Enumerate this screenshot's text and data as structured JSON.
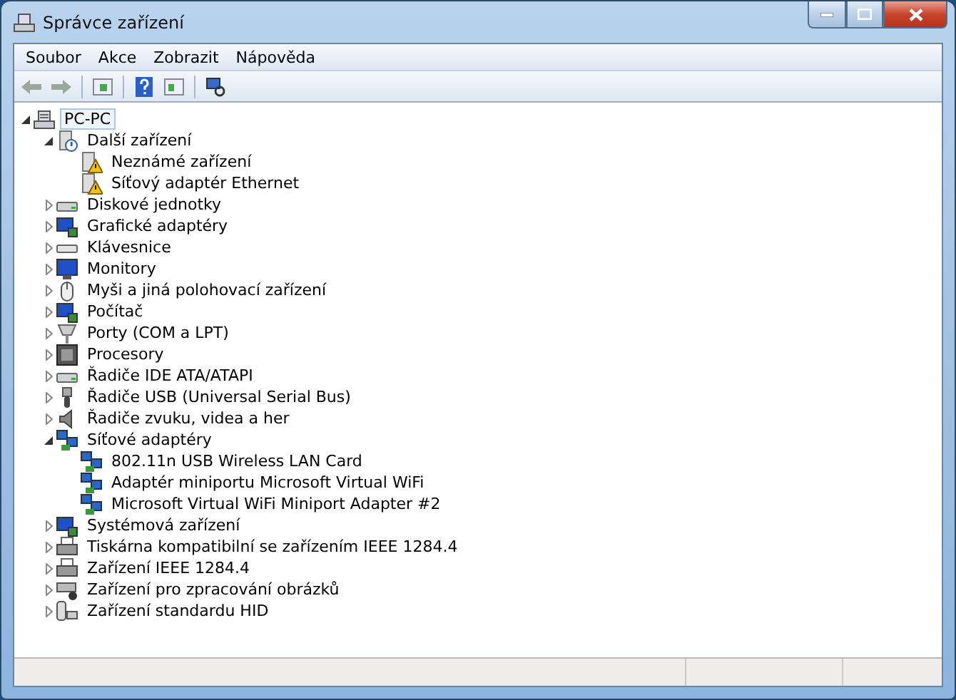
{
  "window": {
    "title": "Správce zařízení"
  },
  "menu": [
    "Soubor",
    "Akce",
    "Zobrazit",
    "Nápověda"
  ],
  "tree": [
    {
      "label": "PC-PC",
      "kind": "computer",
      "selected": true,
      "expanded": true,
      "children": [
        {
          "label": "Další zařízení",
          "kind": "unknown",
          "selected": false,
          "expanded": true,
          "children": [
            {
              "label": "Neznámé zařízení",
              "kind": "warning",
              "selected": false
            },
            {
              "label": "Síťový adaptér Ethernet",
              "kind": "warning",
              "selected": false
            }
          ]
        },
        {
          "label": "Diskové jednotky",
          "kind": "disk",
          "selected": false,
          "expanded": false
        },
        {
          "label": "Grafické adaptéry",
          "kind": "display",
          "selected": false,
          "expanded": false
        },
        {
          "label": "Klávesnice",
          "kind": "keyboard",
          "selected": false,
          "expanded": false
        },
        {
          "label": "Monitory",
          "kind": "monitor",
          "selected": false,
          "expanded": false
        },
        {
          "label": "Myši a jiná polohovací zařízení",
          "kind": "mouse",
          "selected": false,
          "expanded": false
        },
        {
          "label": "Počítač",
          "kind": "display",
          "selected": false,
          "expanded": false
        },
        {
          "label": "Porty (COM a LPT)",
          "kind": "port",
          "selected": false,
          "expanded": false
        },
        {
          "label": "Procesory",
          "kind": "cpu",
          "selected": false,
          "expanded": false
        },
        {
          "label": "Řadiče IDE ATA/ATAPI",
          "kind": "disk",
          "selected": false,
          "expanded": false
        },
        {
          "label": "Řadiče USB (Universal Serial Bus)",
          "kind": "usb",
          "selected": false,
          "expanded": false
        },
        {
          "label": "Řadiče zvuku, videa a her",
          "kind": "sound",
          "selected": false,
          "expanded": false
        },
        {
          "label": "Síťové adaptéry",
          "kind": "network",
          "selected": false,
          "expanded": true,
          "children": [
            {
              "label": "802.11n USB Wireless LAN Card",
              "kind": "network",
              "selected": false
            },
            {
              "label": "Adaptér miniportu Microsoft Virtual WiFi",
              "kind": "network",
              "selected": false
            },
            {
              "label": "Microsoft Virtual WiFi Miniport Adapter #2",
              "kind": "network",
              "selected": false
            }
          ]
        },
        {
          "label": "Systémová zařízení",
          "kind": "display",
          "selected": false,
          "expanded": false
        },
        {
          "label": "Tiskárna kompatibilní se zařízením IEEE 1284.4",
          "kind": "printer",
          "selected": false,
          "expanded": false
        },
        {
          "label": "Zařízení IEEE 1284.4",
          "kind": "printer",
          "selected": false,
          "expanded": false
        },
        {
          "label": "Zařízení pro zpracování obrázků",
          "kind": "scanner",
          "selected": false,
          "expanded": false
        },
        {
          "label": "Zařízení standardu HID",
          "kind": "hid",
          "selected": false,
          "expanded": false
        }
      ]
    }
  ]
}
